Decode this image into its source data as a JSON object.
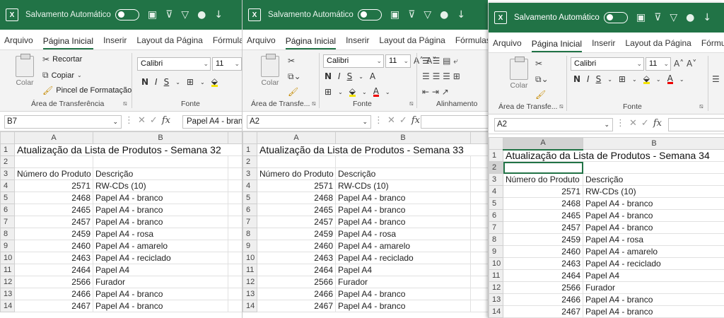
{
  "common": {
    "autosave_label": "Salvamento Automático",
    "app_logo": "X",
    "menu": [
      "Arquivo",
      "Página Inicial",
      "Inserir",
      "Layout da Página",
      "Fórmulas"
    ],
    "clipboard": {
      "paste": "Colar",
      "cut": "Recortar",
      "copy": "Copiar",
      "format_painter": "Pincel de Formatação",
      "group": "Área de Transferência",
      "group_short": "Área de Transfe..."
    },
    "font": {
      "name": "Calibri",
      "size": "11",
      "group": "Fonte"
    },
    "alignment_group": "Alinhamento",
    "columns": [
      "A",
      "B"
    ],
    "header_product": "Número do Produto",
    "header_desc": "Descrição",
    "colors": {
      "excel_green": "#217346",
      "font_red": "#e00000",
      "highlight_yellow": "#f5e400"
    }
  },
  "windows": [
    {
      "name_box": "B7",
      "formula": "Papel A4 - bran",
      "title": "Atualização da Lista de Produtos - Semana 32",
      "rows": [
        {
          "n": "1"
        },
        {
          "n": "2"
        },
        {
          "n": "3"
        },
        {
          "n": "4",
          "a": "2571",
          "b": "RW-CDs (10)"
        },
        {
          "n": "5",
          "a": "2468",
          "b": "Papel A4 - branco"
        },
        {
          "n": "6",
          "a": "2465",
          "b": "Papel A4 - branco"
        },
        {
          "n": "7",
          "a": "2457",
          "b": "Papel A4 - branco"
        },
        {
          "n": "8",
          "a": "2459",
          "b": "Papel A4 - rosa"
        },
        {
          "n": "9",
          "a": "2460",
          "b": "Papel A4 - amarelo"
        },
        {
          "n": "10",
          "a": "2463",
          "b": "Papel A4 - reciclado"
        },
        {
          "n": "11",
          "a": "2464",
          "b": "Papel A4"
        },
        {
          "n": "12",
          "a": "2566",
          "b": "Furador"
        },
        {
          "n": "13",
          "a": "2466",
          "b": "Papel A4 - branco"
        },
        {
          "n": "14",
          "a": "2467",
          "b": "Papel A4 - branco"
        }
      ]
    },
    {
      "name_box": "A2",
      "formula": "",
      "title": "Atualização da Lista de Produtos - Semana 33",
      "rows": [
        {
          "n": "1"
        },
        {
          "n": "2"
        },
        {
          "n": "3"
        },
        {
          "n": "4",
          "a": "2571",
          "b": "RW-CDs (10)"
        },
        {
          "n": "5",
          "a": "2468",
          "b": "Papel A4 - branco"
        },
        {
          "n": "6",
          "a": "2465",
          "b": "Papel A4 - branco"
        },
        {
          "n": "7",
          "a": "2457",
          "b": "Papel A4 - branco"
        },
        {
          "n": "8",
          "a": "2459",
          "b": "Papel A4 - rosa"
        },
        {
          "n": "9",
          "a": "2460",
          "b": "Papel A4 - amarelo"
        },
        {
          "n": "10",
          "a": "2463",
          "b": "Papel A4 - reciclado"
        },
        {
          "n": "11",
          "a": "2464",
          "b": "Papel A4"
        },
        {
          "n": "12",
          "a": "2566",
          "b": "Furador"
        },
        {
          "n": "13",
          "a": "2466",
          "b": "Papel A4 - branco"
        },
        {
          "n": "14",
          "a": "2467",
          "b": "Papel A4 - branco"
        }
      ]
    },
    {
      "name_box": "A2",
      "formula": "",
      "title": "Atualização da Lista de Produtos - Semana 34",
      "rows": [
        {
          "n": "1"
        },
        {
          "n": "2"
        },
        {
          "n": "3"
        },
        {
          "n": "4",
          "a": "2571",
          "b": "RW-CDs (10)"
        },
        {
          "n": "5",
          "a": "2468",
          "b": "Papel A4 - branco"
        },
        {
          "n": "6",
          "a": "2465",
          "b": "Papel A4 - branco"
        },
        {
          "n": "7",
          "a": "2457",
          "b": "Papel A4 - branco"
        },
        {
          "n": "8",
          "a": "2459",
          "b": "Papel A4 - rosa"
        },
        {
          "n": "9",
          "a": "2460",
          "b": "Papel A4 - amarelo"
        },
        {
          "n": "10",
          "a": "2463",
          "b": "Papel A4 - reciclado"
        },
        {
          "n": "11",
          "a": "2464",
          "b": "Papel A4"
        },
        {
          "n": "12",
          "a": "2566",
          "b": "Furador"
        },
        {
          "n": "13",
          "a": "2466",
          "b": "Papel A4 - branco"
        },
        {
          "n": "14",
          "a": "2467",
          "b": "Papel A4 - branco"
        }
      ]
    }
  ]
}
